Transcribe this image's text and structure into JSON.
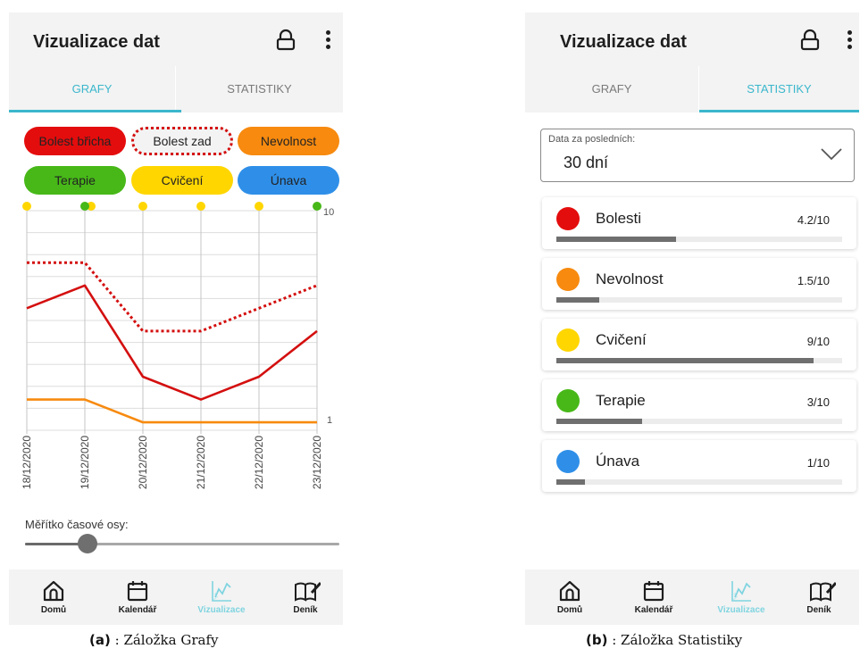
{
  "screens": [
    {
      "app_title": "Vizualizace dat",
      "tabs": [
        {
          "label": "GRAFY",
          "active": true
        },
        {
          "label": "STATISTIKY",
          "active": false
        }
      ],
      "chips": [
        {
          "label": "Bolest břicha",
          "color": "#e40d0d",
          "style": "filled"
        },
        {
          "label": "Bolest zad",
          "color": "#d40f0f",
          "style": "dotted"
        },
        {
          "label": "Nevolnost",
          "color": "#f78a0f"
        },
        {
          "label": "Terapie",
          "color": "#47b818"
        },
        {
          "label": "Cvičení",
          "color": "#ffd600"
        },
        {
          "label": "Únava",
          "color": "#2f8fe8"
        }
      ],
      "scale_label": "Měřítko časové osy:",
      "slider_value": 0.2,
      "nav": [
        {
          "label": "Domů",
          "icon": "home-icon"
        },
        {
          "label": "Kalendář",
          "icon": "calendar-icon"
        },
        {
          "label": "Vizualizace",
          "icon": "chart-icon",
          "active": true
        },
        {
          "label": "Deník",
          "icon": "book-icon"
        }
      ]
    },
    {
      "app_title": "Vizualizace dat",
      "tabs": [
        {
          "label": "GRAFY",
          "active": false
        },
        {
          "label": "STATISTIKY",
          "active": true
        }
      ],
      "dropdown": {
        "label": "Data za posledních:",
        "value": "30 dní"
      },
      "stats": [
        {
          "name": "Bolesti",
          "value_text": "4.2/10",
          "value": 4.2,
          "color": "#e40d0d"
        },
        {
          "name": "Nevolnost",
          "value_text": "1.5/10",
          "value": 1.5,
          "color": "#f78a0f"
        },
        {
          "name": "Cvičení",
          "value_text": "9/10",
          "value": 9,
          "color": "#ffd600"
        },
        {
          "name": "Terapie",
          "value_text": "3/10",
          "value": 3,
          "color": "#47b818"
        },
        {
          "name": "Únava",
          "value_text": "1/10",
          "value": 1,
          "color": "#2f8fe8"
        }
      ],
      "nav": [
        {
          "label": "Domů",
          "icon": "home-icon"
        },
        {
          "label": "Kalendář",
          "icon": "calendar-icon"
        },
        {
          "label": "Vizualizace",
          "icon": "chart-icon",
          "active": true
        },
        {
          "label": "Deník",
          "icon": "book-icon"
        }
      ]
    }
  ],
  "captions": [
    {
      "tag": "(a)",
      "text": ": Záložka Grafy"
    },
    {
      "tag": "(b)",
      "text": ": Záložka Statistiky"
    }
  ],
  "colors": {
    "accent": "#3bb7cc",
    "bar_bg": "#f3f3f3"
  },
  "chart_data": {
    "type": "line",
    "categories": [
      "18/12/2020",
      "19/12/2020",
      "20/12/2020",
      "21/12/2020",
      "22/12/2020",
      "23/12/2020"
    ],
    "ylim": [
      1,
      10
    ],
    "y_tick_labels": [
      "10",
      "1"
    ],
    "series": [
      {
        "name": "Bolest břicha",
        "values": [
          5.8,
          6.8,
          2.8,
          1.8,
          2.8,
          4.8
        ],
        "color": "#d40f0f",
        "style": "solid"
      },
      {
        "name": "Bolest zad",
        "values": [
          7.8,
          7.8,
          4.8,
          4.8,
          5.8,
          6.8
        ],
        "color": "#d40f0f",
        "style": "dotted"
      },
      {
        "name": "Nevolnost",
        "values": [
          1.8,
          1.8,
          0.8,
          0.8,
          0.8,
          0.8
        ],
        "color": "#f78a0f",
        "style": "solid"
      }
    ],
    "event_markers": [
      {
        "series": "Cvičení",
        "color": "#ffd600",
        "dates": [
          "18/12/2020",
          "19/12/2020",
          "20/12/2020",
          "21/12/2020",
          "22/12/2020"
        ]
      },
      {
        "series": "Terapie",
        "color": "#47b818",
        "dates": [
          "19/12/2020",
          "23/12/2020"
        ]
      }
    ],
    "grid": true
  }
}
